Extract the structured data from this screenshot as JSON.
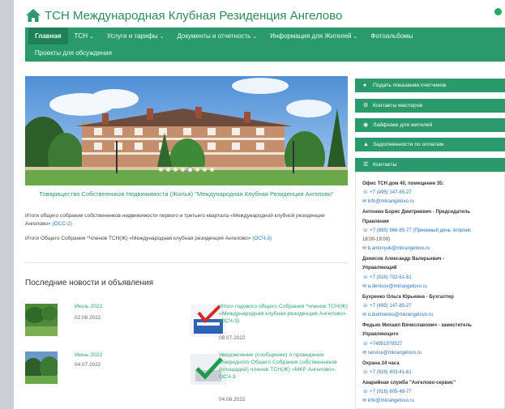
{
  "header": {
    "title": "ТСН Международная Клубная Резиденция Ангелово"
  },
  "nav": {
    "row1": [
      {
        "label": "Главная",
        "active": true,
        "caret": false
      },
      {
        "label": "ТСН",
        "active": false,
        "caret": true
      },
      {
        "label": "Услуги и тарифы",
        "active": false,
        "caret": true
      },
      {
        "label": "Документы и отчетность",
        "active": false,
        "caret": true
      },
      {
        "label": "Информация для Жителей",
        "active": false,
        "caret": true
      },
      {
        "label": "Фотоальбомы",
        "active": false,
        "caret": false
      }
    ],
    "row2": [
      {
        "label": "Проекты для обсуждения",
        "active": false,
        "caret": false
      }
    ],
    "caret_glyph": "⌄"
  },
  "hero": {
    "slide_count": 8,
    "active_slide": 4
  },
  "caption": "Товарищество Собственников Недвижимости (Жилья) \"Международная Клубная Резиденция Ангелово\"",
  "paragraphs": [
    {
      "text": "Итоги общего собрания собственников недвижимости первого и третьего квартала «Международной клубной резиденции Ангелово» ",
      "link": "(ОСС-2)"
    },
    {
      "text": "Итоги Общего Собрания *Членов ТСН(Ж) «Международная клубная резиденция Ангелово» ",
      "link": "(ОСЧ-3)"
    }
  ],
  "news": {
    "heading": "Последние новости и объявления",
    "items": [
      {
        "title": "Июль 2022",
        "date": "02.08.2022"
      },
      {
        "title": "Итоги годового общего Собрания *членов ТСН(Ж) «Международная клубная резиденция Ангелово» (ОСЧ-3)",
        "date": "08.07.2022"
      },
      {
        "title": "Июнь 2022",
        "date": "04.07.2022"
      },
      {
        "title": "Уведомление (сообщение) о проведении Очередного Общего Собрания собственников (площадей) членов ТСН(Ж) «МКР Ангелово» ОСЧ-3",
        "date": "04.06.2022"
      }
    ]
  },
  "sidebar": {
    "buttons": [
      {
        "label": "Подать показания счетчиков",
        "icon": "water-drop-icon",
        "glyph": "●"
      },
      {
        "label": "Контакты мастеров",
        "icon": "gear-icon",
        "glyph": "⚙"
      },
      {
        "label": "Лайфхаки для жителей",
        "icon": "lightbulb-icon",
        "glyph": "◉"
      },
      {
        "label": "Задолженности по оплатам",
        "icon": "warning-icon",
        "glyph": "▲"
      },
      {
        "label": "Контакты",
        "icon": "contacts-icon",
        "glyph": "☰"
      }
    ],
    "contacts": [
      {
        "type": "strong",
        "text": "Офис ТСН дом 40, помещение 35:"
      },
      {
        "type": "phone",
        "text": "☏ +7 (495) 147-85-27"
      },
      {
        "type": "mail",
        "text": "✉ info@mkrangelovo.ru"
      },
      {
        "type": "strong",
        "text": "Антонюк Борис Дмитриевич - Председатель"
      },
      {
        "type": "strong",
        "text": "Правления"
      },
      {
        "type": "phone",
        "text": "☏ +7 (985) 966-85-77 (Приемный день: вторник"
      },
      {
        "type": "plain",
        "text": "18:00-19:00)"
      },
      {
        "type": "mail",
        "text": "✉ b.antonyuk@mkrangelovo.ru"
      },
      {
        "type": "strong",
        "text": "Денисов Александр Валерьевич -"
      },
      {
        "type": "strong",
        "text": "Управляющий"
      },
      {
        "type": "phone",
        "text": "☏ +7 (926) 702-61-61"
      },
      {
        "type": "mail",
        "text": "✉ a.denisov@mkrangelovo.ru"
      },
      {
        "type": "strong",
        "text": "Бухренко Ольга Юрьевна - Бухгалтер"
      },
      {
        "type": "phone",
        "text": "☏ +7 (495) 147-85-27"
      },
      {
        "type": "mail",
        "text": "✉ o.bukhrenko@mkrangelovo.ru"
      },
      {
        "type": "strong",
        "text": "Федько Михаил Вячеславович - заместитель"
      },
      {
        "type": "strong",
        "text": "Управляющего"
      },
      {
        "type": "phone",
        "text": "☏ +74951978527"
      },
      {
        "type": "mail",
        "text": "✉ service@mkrangelovo.ru"
      },
      {
        "type": "strong",
        "text": "Охрана 24 часа"
      },
      {
        "type": "phone",
        "text": "☏ +7 (926) 403-41-61"
      },
      {
        "type": "strong",
        "text": "Аварийная служба \"Ангелово-сервис\""
      },
      {
        "type": "phone",
        "text": "☏ +7 (916) 805-48-77"
      },
      {
        "type": "mail",
        "text": "✉ info@mkrangelovo.ru"
      }
    ]
  },
  "colors": {
    "brand": "#2a9a6c",
    "link": "#2a74c0"
  }
}
